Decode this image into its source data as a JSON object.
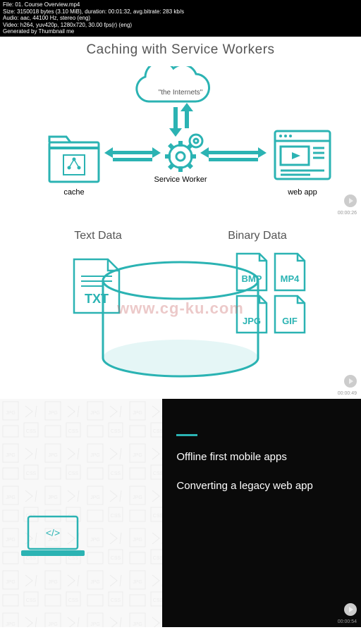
{
  "meta": {
    "file": "File: 01. Course Overview.mp4",
    "size": "Size: 3150018 bytes (3.10 MiB), duration: 00:01:32, avg.bitrate: 283 kb/s",
    "audio": "Audio: aac, 44100 Hz, stereo (eng)",
    "video": "Video: h264, yuv420p, 1280x720, 30.00 fps(r) (eng)",
    "gen": "Generated by Thumbnail me"
  },
  "slide1": {
    "title": "Caching with Service Workers",
    "cloud": "\"the Internets\"",
    "sw": "Service Worker",
    "cache": "cache",
    "web": "web app",
    "ts": "00:00:26"
  },
  "slide2": {
    "left": "Text Data",
    "right": "Binary Data",
    "txt": "TXT",
    "bmp": "BMP",
    "mp4": "MP4",
    "jpg": "JPG",
    "gif": "GIF",
    "watermark": "www.cg-ku.com",
    "ts": "00:00:49"
  },
  "slide3": {
    "line1": "Offline first mobile apps",
    "line2": "Converting a legacy web app",
    "ts": "00:00:54"
  }
}
